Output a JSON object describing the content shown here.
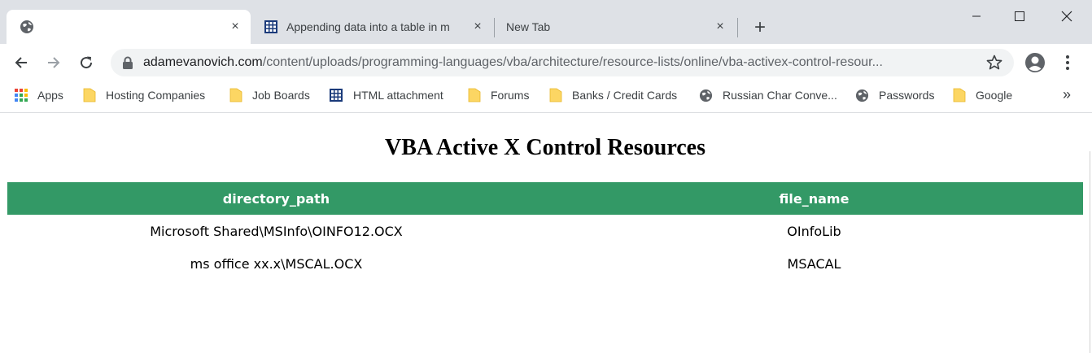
{
  "browser": {
    "tabs": [
      {
        "title": "",
        "close": "×",
        "icon": "globe-icon",
        "active": true
      },
      {
        "title": "Appending data into a table in m",
        "close": "×",
        "icon": "table-icon",
        "active": false
      },
      {
        "title": "New Tab",
        "close": "×",
        "icon": "",
        "active": false
      }
    ],
    "new_tab_label": "+",
    "url_host": "adamevanovich.com",
    "url_path": "/content/uploads/programming-languages/vba/architecture/resource-lists/online/vba-activex-control-resour...",
    "more_bookmarks": "»"
  },
  "bookmarks": [
    {
      "label": "Apps",
      "icon": "apps-grid-icon"
    },
    {
      "label": "Hosting Companies",
      "icon": "folder-icon"
    },
    {
      "label": "Job Boards",
      "icon": "folder-icon"
    },
    {
      "label": "HTML attachment",
      "icon": "table-icon"
    },
    {
      "label": "Forums",
      "icon": "folder-icon"
    },
    {
      "label": "Banks / Credit Cards",
      "icon": "folder-icon"
    },
    {
      "label": "Russian Char Conve...",
      "icon": "globe-icon"
    },
    {
      "label": "Passwords",
      "icon": "globe-icon"
    },
    {
      "label": "Google",
      "icon": "folder-icon"
    }
  ],
  "page": {
    "title": "VBA Active X Control Resources",
    "table": {
      "headers": [
        "directory_path",
        "file_name"
      ],
      "rows": [
        [
          "Microsoft Shared\\MSInfo\\OINFO12.OCX",
          "OInfoLib"
        ],
        [
          "ms office xx.x\\MSCAL.OCX",
          "MSACAL"
        ]
      ]
    }
  },
  "colors": {
    "tab_strip": "#dee1e6",
    "omnibox": "#f1f3f4",
    "table_header": "#339966",
    "folder": "#fcd663"
  }
}
